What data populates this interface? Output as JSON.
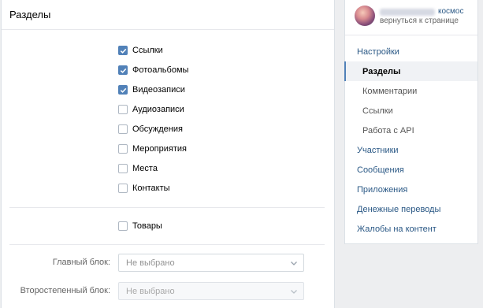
{
  "main": {
    "title": "Разделы",
    "sections": [
      {
        "label": "Ссылки",
        "checked": true
      },
      {
        "label": "Фотоальбомы",
        "checked": true
      },
      {
        "label": "Видеозаписи",
        "checked": true
      },
      {
        "label": "Аудиозаписи",
        "checked": false
      },
      {
        "label": "Обсуждения",
        "checked": false
      },
      {
        "label": "Мероприятия",
        "checked": false
      },
      {
        "label": "Места",
        "checked": false
      },
      {
        "label": "Контакты",
        "checked": false
      }
    ],
    "goods": {
      "label": "Товары",
      "checked": false
    },
    "main_block": {
      "label": "Главный блок:",
      "value": "Не выбрано"
    },
    "secondary_block": {
      "label": "Второстепенный блок:",
      "value": "Не выбрано"
    }
  },
  "sidebar": {
    "community_name": "космос",
    "back_link": "вернуться к странице",
    "menu": [
      {
        "label": "Настройки",
        "level": 0,
        "active": false
      },
      {
        "label": "Разделы",
        "level": 1,
        "active": true
      },
      {
        "label": "Комментарии",
        "level": 1,
        "active": false
      },
      {
        "label": "Ссылки",
        "level": 1,
        "active": false
      },
      {
        "label": "Работа с API",
        "level": 1,
        "active": false
      },
      {
        "label": "Участники",
        "level": 0,
        "active": false
      },
      {
        "label": "Сообщения",
        "level": 0,
        "active": false
      },
      {
        "label": "Приложения",
        "level": 0,
        "active": false
      },
      {
        "label": "Денежные переводы",
        "level": 0,
        "active": false
      },
      {
        "label": "Жалобы на контент",
        "level": 0,
        "active": false
      }
    ]
  },
  "colors": {
    "accent": "#5181b8",
    "link": "#2a5885",
    "background": "#edeef0"
  },
  "icons": [
    "checkmark-icon",
    "chevron-down-icon",
    "avatar"
  ]
}
